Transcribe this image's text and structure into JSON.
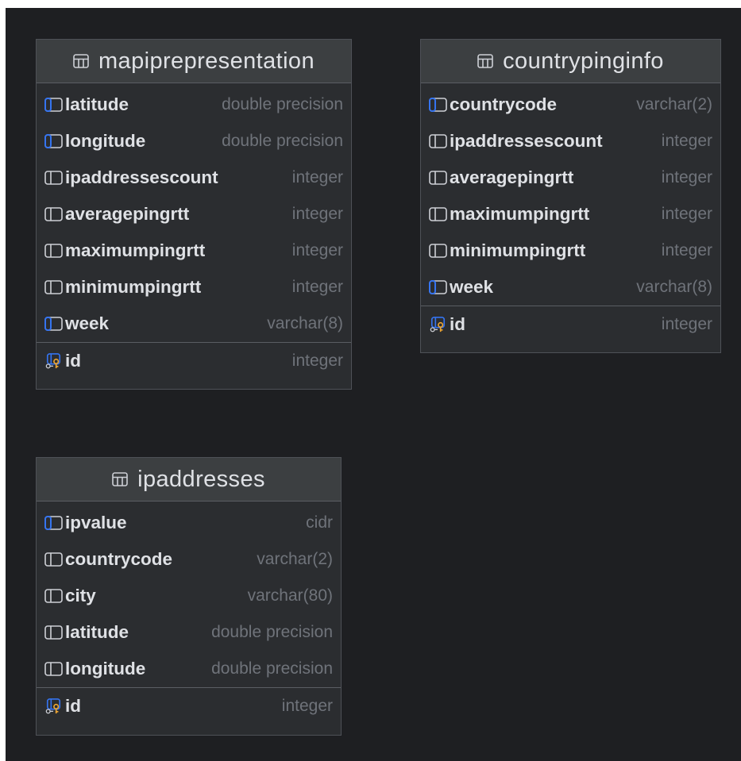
{
  "tables": [
    {
      "name": "mapiprepresentation",
      "columns": [
        {
          "name": "latitude",
          "type": "double precision",
          "indexed": true
        },
        {
          "name": "longitude",
          "type": "double precision",
          "indexed": true
        },
        {
          "name": "ipaddressescount",
          "type": "integer",
          "indexed": false
        },
        {
          "name": "averagepingrtt",
          "type": "integer",
          "indexed": false
        },
        {
          "name": "maximumpingrtt",
          "type": "integer",
          "indexed": false
        },
        {
          "name": "minimumpingrtt",
          "type": "integer",
          "indexed": false
        },
        {
          "name": "week",
          "type": "varchar(8)",
          "indexed": true
        }
      ],
      "keys": [
        {
          "name": "id",
          "type": "integer",
          "icon": "primary-key-icon"
        }
      ]
    },
    {
      "name": "countrypinginfo",
      "columns": [
        {
          "name": "countrycode",
          "type": "varchar(2)",
          "indexed": true
        },
        {
          "name": "ipaddressescount",
          "type": "integer",
          "indexed": false
        },
        {
          "name": "averagepingrtt",
          "type": "integer",
          "indexed": false
        },
        {
          "name": "maximumpingrtt",
          "type": "integer",
          "indexed": false
        },
        {
          "name": "minimumpingrtt",
          "type": "integer",
          "indexed": false
        },
        {
          "name": "week",
          "type": "varchar(8)",
          "indexed": true
        }
      ],
      "keys": [
        {
          "name": "id",
          "type": "integer",
          "icon": "primary-key-icon"
        }
      ]
    },
    {
      "name": "ipaddresses",
      "columns": [
        {
          "name": "ipvalue",
          "type": "cidr",
          "indexed": true
        },
        {
          "name": "countrycode",
          "type": "varchar(2)",
          "indexed": false
        },
        {
          "name": "city",
          "type": "varchar(80)",
          "indexed": false
        },
        {
          "name": "latitude",
          "type": "double precision",
          "indexed": false
        },
        {
          "name": "longitude",
          "type": "double precision",
          "indexed": false
        }
      ],
      "keys": [
        {
          "name": "id",
          "type": "integer",
          "icon": "primary-key-icon"
        }
      ]
    }
  ],
  "colors": {
    "canvas_background": "#1e1f22",
    "table_background": "#2b2d30",
    "header_background": "#3c3f41",
    "column_name": "#dfe1e5",
    "column_type": "#6f737a",
    "index_accent": "#3574f0",
    "key_accent": "#f0a732",
    "icon_outline": "#ced0d6"
  }
}
